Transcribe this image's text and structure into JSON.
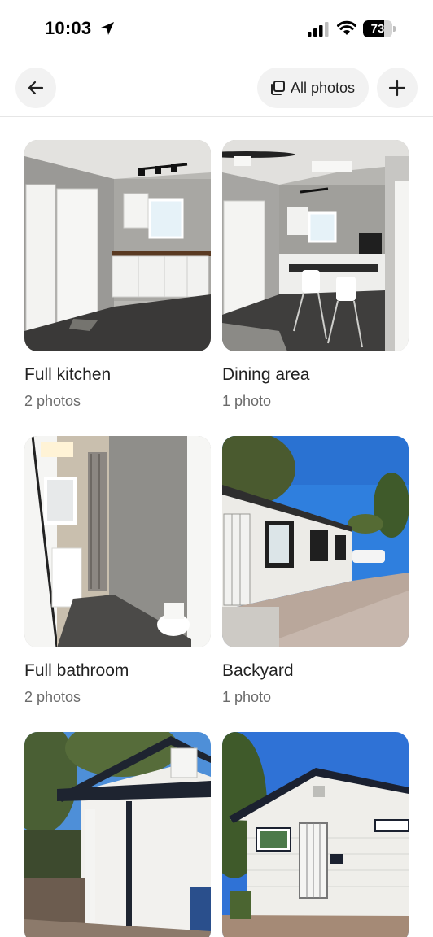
{
  "status_bar": {
    "time": "10:03",
    "battery_level": "73",
    "battery_fraction": 0.73,
    "icons": [
      "location-arrow-icon",
      "cellular-signal-icon",
      "wifi-icon",
      "battery-icon"
    ]
  },
  "nav": {
    "back_icon": "arrow-left-icon",
    "all_photos_label": "All photos",
    "all_photos_icon": "photo-stack-icon",
    "add_icon": "plus-icon"
  },
  "rooms": [
    {
      "title": "Full kitchen",
      "count": "2 photos"
    },
    {
      "title": "Dining area",
      "count": "1 photo"
    },
    {
      "title": "Full bathroom",
      "count": "2 photos"
    },
    {
      "title": "Backyard",
      "count": "1 photo"
    },
    {
      "title": "",
      "count": ""
    },
    {
      "title": "",
      "count": ""
    }
  ],
  "colors": {
    "text_primary": "#222222",
    "text_secondary": "#6a6a6a",
    "button_bg": "#f2f2f2",
    "divider": "#e6e6e6"
  }
}
